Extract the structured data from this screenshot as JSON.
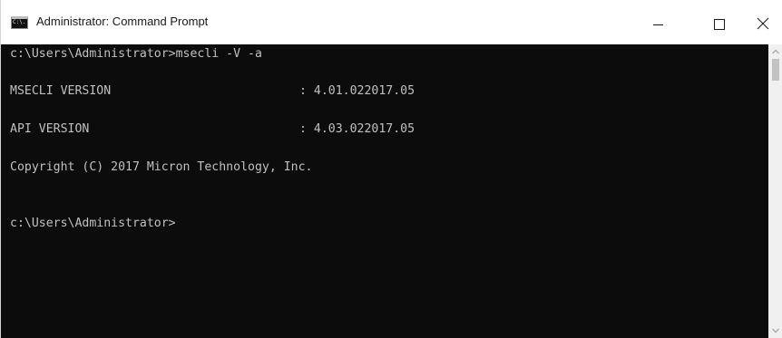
{
  "window": {
    "title": "Administrator: Command Prompt",
    "app_icon": "cmd-icon",
    "app_icon_label": "C:\\.",
    "controls": {
      "minimize_icon": "minimize-icon",
      "maximize_icon": "maximize-icon",
      "close_icon": "close-icon"
    }
  },
  "console": {
    "background": "#0c0c0c",
    "foreground": "#c0c0c0",
    "lines": [
      {
        "text": "c:\\Users\\Administrator>msecli -V -a"
      },
      {
        "label": "MSECLI VERSION",
        "value": ": 4.01.022017.05"
      },
      {
        "label": "API VERSION",
        "value": ": 4.03.022017.05"
      },
      {
        "text": "Copyright (C) 2017 Micron Technology, Inc."
      },
      {
        "text": "c:\\Users\\Administrator>"
      }
    ]
  },
  "scrollbar": {
    "up_icon": "scroll-up-arrow-icon",
    "down_icon": "scroll-down-arrow-icon"
  }
}
